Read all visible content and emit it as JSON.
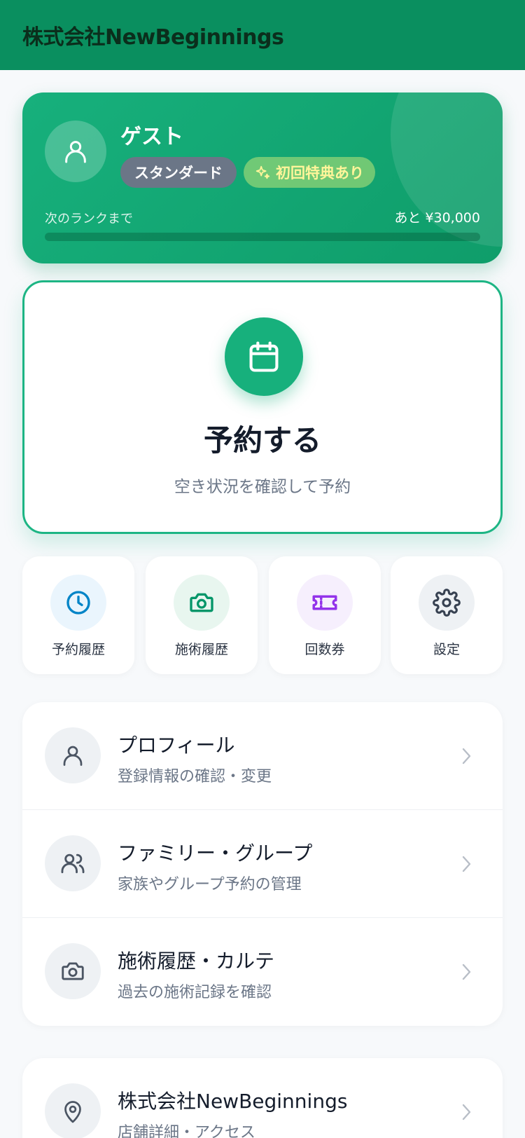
{
  "header": {
    "title": "株式会社NewBeginnings"
  },
  "member": {
    "name": "ゲスト",
    "rank_badge": "スタンダード",
    "benefit_badge": "初回特典あり",
    "next_rank_label": "次のランクまで",
    "next_rank_amount": "あと ¥30,000",
    "progress": 0
  },
  "reserve": {
    "title": "予約する",
    "subtitle": "空き状況を確認して予約"
  },
  "tiles": [
    {
      "label": "予約履歴",
      "icon": "clock-icon"
    },
    {
      "label": "施術履歴",
      "icon": "camera-icon"
    },
    {
      "label": "回数券",
      "icon": "ticket-icon"
    },
    {
      "label": "設定",
      "icon": "gear-icon"
    }
  ],
  "menu": [
    {
      "title": "プロフィール",
      "subtitle": "登録情報の確認・変更",
      "icon": "user-icon"
    },
    {
      "title": "ファミリー・グループ",
      "subtitle": "家族やグループ予約の管理",
      "icon": "users-icon"
    },
    {
      "title": "施術履歴・カルテ",
      "subtitle": "過去の施術記録を確認",
      "icon": "camera-icon"
    }
  ],
  "store": {
    "title": "株式会社NewBeginnings",
    "subtitle": "店舗詳細・アクセス",
    "icon": "map-pin-icon"
  },
  "colors": {
    "brand": "#0a8f5f",
    "accent": "#17b07c",
    "tile_clock": "#0284c7",
    "tile_camera": "#059669",
    "tile_ticket": "#9333ea",
    "tile_gear": "#374151"
  }
}
